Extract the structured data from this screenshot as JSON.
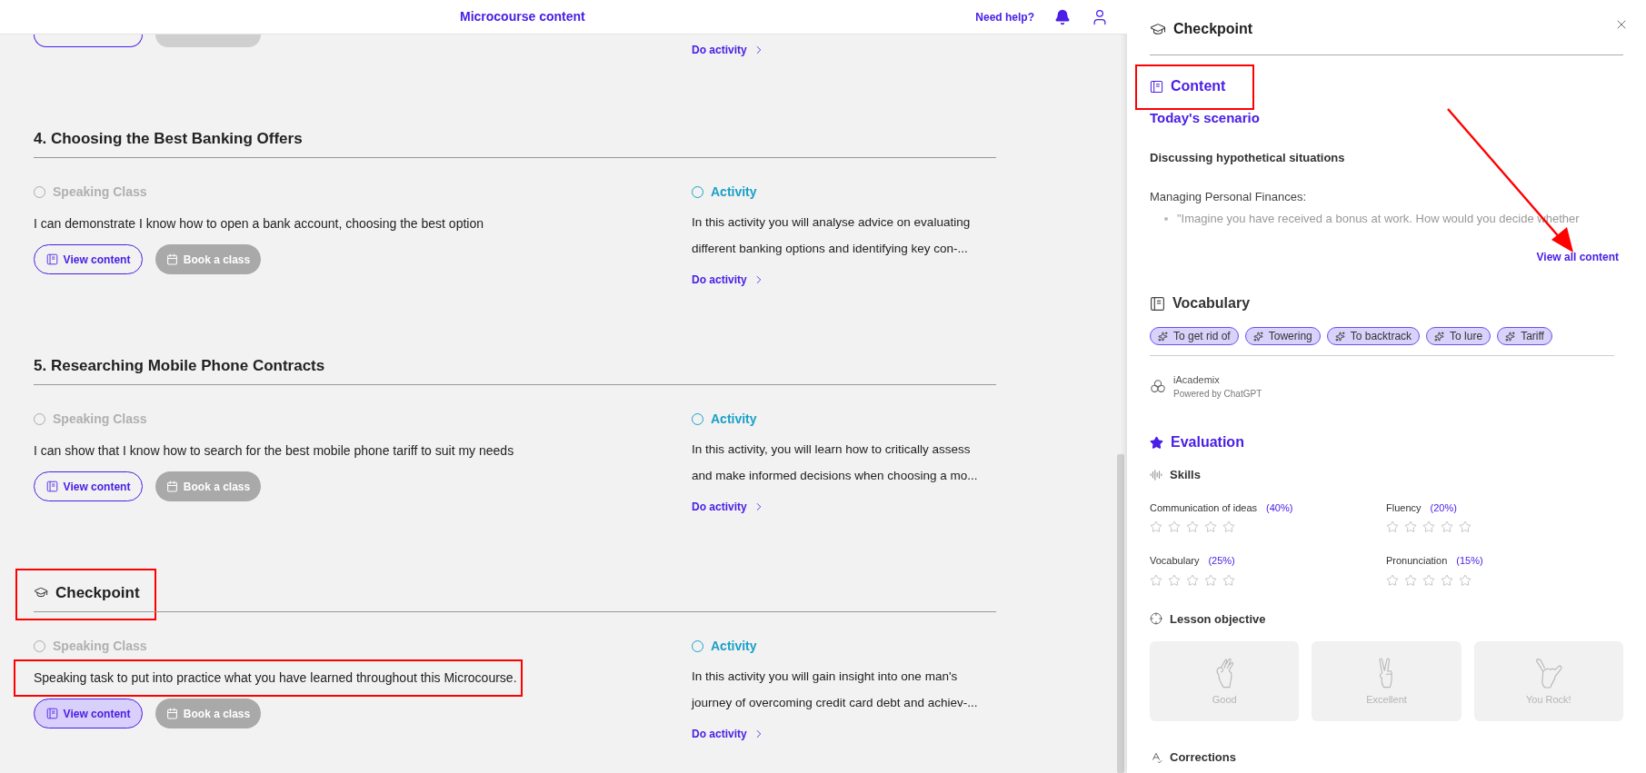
{
  "header": {
    "title": "Microcourse content",
    "help_link": "Need help?"
  },
  "top_section": {
    "link": "Do activity"
  },
  "sections": [
    {
      "kind": "lesson",
      "title": "4. Choosing the Best Banking Offers",
      "highlighted": false,
      "speaking": {
        "label": "Speaking Class",
        "done": false,
        "description": "I can demonstrate I know how to open a bank account, choosing the best option",
        "description_highlighted": false,
        "view_button": {
          "label": "View content",
          "selected": false
        },
        "book_button": {
          "label": "Book a class",
          "disabled": true
        }
      },
      "activity": {
        "label": "Activity",
        "done": false,
        "description_lines": [
          "In this activity you will analyse advice on evaluating",
          "different banking options and identifying key con-..."
        ],
        "link": "Do activity"
      }
    },
    {
      "kind": "lesson",
      "title": "5. Researching Mobile Phone Contracts",
      "highlighted": false,
      "speaking": {
        "label": "Speaking Class",
        "done": false,
        "description": "I can show that I know how to search for the best mobile phone tariff to suit my needs",
        "description_highlighted": false,
        "view_button": {
          "label": "View content",
          "selected": false
        },
        "book_button": {
          "label": "Book a class",
          "disabled": true
        }
      },
      "activity": {
        "label": "Activity",
        "done": false,
        "description_lines": [
          "In this activity, you will learn how to critically assess",
          "and make informed decisions when choosing a mo..."
        ],
        "link": "Do activity"
      }
    },
    {
      "kind": "checkpoint",
      "title": "Checkpoint",
      "highlighted": true,
      "speaking": {
        "label": "Speaking Class",
        "done": false,
        "description": "Speaking task to put into practice what you have learned throughout this Microcourse.",
        "description_highlighted": true,
        "view_button": {
          "label": "View content",
          "selected": true
        },
        "book_button": {
          "label": "Book a class",
          "disabled": true
        }
      },
      "activity": {
        "label": "Activity",
        "done": false,
        "description_lines": [
          "In this activity you will gain insight into one man's",
          "journey of overcoming credit card debt and achiev-..."
        ],
        "link": "Do activity"
      }
    }
  ],
  "panel": {
    "title": "Checkpoint",
    "content": {
      "heading": "Content",
      "highlighted": true,
      "subtitle": "Today's scenario",
      "topic": "Discussing hypothetical situations",
      "intro": "Managing Personal Finances:",
      "bullet": "\"Imagine you have received a bonus at work. How would you decide whether",
      "link": "View all content",
      "pointed": true
    },
    "vocabulary": {
      "heading": "Vocabulary",
      "chips": [
        "To get rid of",
        "Towering",
        "To backtrack",
        "To lure",
        "Tariff"
      ]
    },
    "ai": {
      "name": "iAcademix",
      "note": "Powered by ChatGPT"
    },
    "evaluation": {
      "heading": "Evaluation",
      "skills_heading": "Skills",
      "skills": [
        {
          "name": "Communication of ideas",
          "weight": "(40%)",
          "stars": 0
        },
        {
          "name": "Fluency",
          "weight": "(20%)",
          "stars": 0
        },
        {
          "name": "Vocabulary",
          "weight": "(25%)",
          "stars": 0
        },
        {
          "name": "Pronunciation",
          "weight": "(15%)",
          "stars": 0
        }
      ],
      "objective_heading": "Lesson objective",
      "objectives": [
        {
          "kind": "ok",
          "label": "Good",
          "selected": false
        },
        {
          "kind": "peace",
          "label": "Excellent",
          "selected": false
        },
        {
          "kind": "shaka",
          "label": "You Rock!",
          "selected": false
        }
      ],
      "corrections_heading": "Corrections"
    }
  }
}
